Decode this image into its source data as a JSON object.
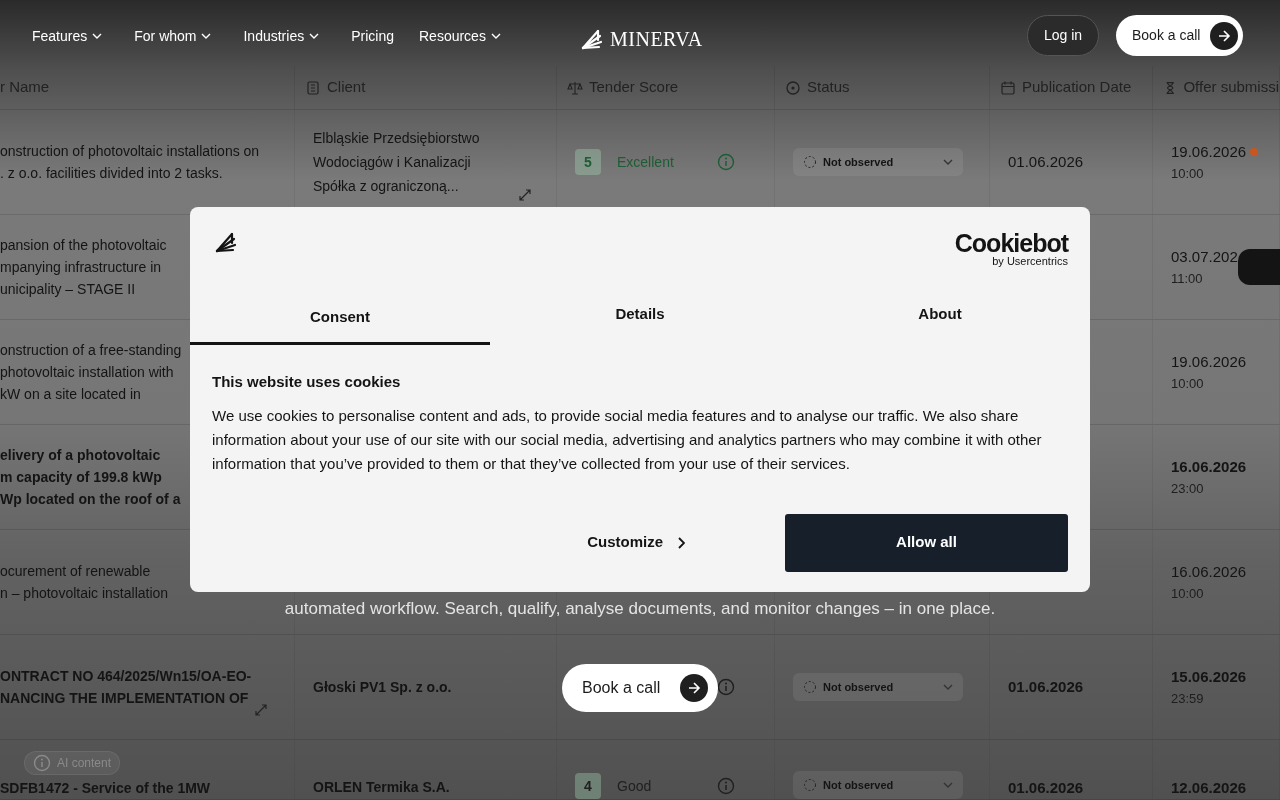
{
  "nav": {
    "links": [
      {
        "label": "Features",
        "dropdown": true
      },
      {
        "label": "For whom",
        "dropdown": true
      },
      {
        "label": "Industries",
        "dropdown": true
      },
      {
        "label": "Pricing",
        "dropdown": false
      },
      {
        "label": "Resources",
        "dropdown": true
      }
    ],
    "brand": "MINERVA",
    "login": "Log in",
    "cta": "Book a call"
  },
  "table": {
    "columns": [
      "r Name",
      "Client",
      "Tender Score",
      "Status",
      "Publication Date",
      "Offer submissi"
    ],
    "rows": [
      {
        "unread": false,
        "name": [
          "onstruction of photovoltaic installations on",
          ". z o.o. facilities divided into 2 tasks."
        ],
        "client": [
          "Elbląskie Przedsiębiorstwo",
          "Wodociągów i Kanalizacji",
          "Spółka z ograniczoną..."
        ],
        "client_expand": true,
        "score": {
          "value": "5",
          "label": "Excellent",
          "color": "#1e5c34"
        },
        "status": "Not observed",
        "published": "01.06.2026",
        "deadline": "19.06.2026",
        "deadline_time": "10:00",
        "dot": {
          "color": "#c8561e"
        }
      },
      {
        "unread": false,
        "name": [
          "pansion of the photovoltaic",
          "mpanying infrastructure in",
          "unicipality – STAGE II"
        ],
        "deadline": "03.07.202",
        "deadline_time": "11:00"
      },
      {
        "unread": false,
        "name": [
          "onstruction of a free-standing",
          "photovoltaic installation with",
          "kW on a site located in"
        ],
        "deadline": "19.06.2026",
        "deadline_time": "10:00"
      },
      {
        "unread": true,
        "name": [
          "elivery of a photovoltaic",
          "m capacity of 199.8 kWp",
          "Wp located on the roof of a"
        ],
        "deadline": "16.06.2026",
        "deadline_time": "23:00"
      },
      {
        "unread": false,
        "name": [
          "ocurement of renewable",
          "n – photovoltaic installation"
        ],
        "deadline": "16.06.2026",
        "deadline_time": "10:00"
      },
      {
        "unread": true,
        "name": [
          "ONTRACT NO 464/2025/Wn15/OA-EO-",
          "NANCING THE IMPLEMENTATION OF"
        ],
        "name_expand": true,
        "client": [
          "Głoski PV1 Sp. z o.o."
        ],
        "client_expand": false,
        "score": {},
        "status": "Not observed",
        "published": "01.06.2026",
        "deadline": "15.06.2026",
        "deadline_time": "23:59"
      },
      {
        "unread": true,
        "name": [
          "SDFB1472 - Service of the 1MW"
        ],
        "client": [
          "ORLEN Termika S.A."
        ],
        "client_expand": false,
        "score": {
          "value": "4",
          "label": "Good",
          "color": "#202020"
        },
        "status": "Not observed",
        "published": "01.06.2026",
        "deadline": "12.06.2026"
      }
    ]
  },
  "ai_chip": "AI content",
  "hero": {
    "text": "automated workflow. Search, qualify, analyse documents, and monitor changes – in one place.",
    "cta": "Book a call"
  },
  "cookie_dialog": {
    "brand_title": "Cookiebot",
    "brand_sub": "by Usercentrics",
    "tabs": [
      {
        "label": "Consent",
        "selected": true
      },
      {
        "label": "Details",
        "selected": false
      },
      {
        "label": "About",
        "selected": false
      }
    ],
    "heading": "This website uses cookies",
    "body": "We use cookies to personalise content and ads, to provide social media features and to analyse our traffic. We also share information about your use of our site with our social media, advertising and analytics partners who may combine it with other information that you’ve provided to them or that they’ve collected from your use of their services.",
    "customize": "Customize",
    "allow": "Allow all"
  }
}
